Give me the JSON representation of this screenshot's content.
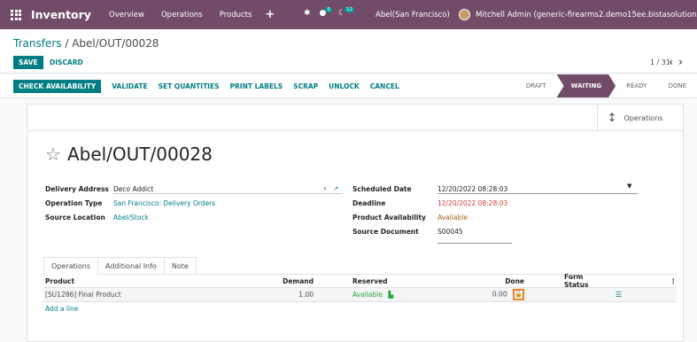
{
  "topbar": {
    "brand": "Inventory",
    "menu": [
      "Overview",
      "Operations",
      "Products"
    ],
    "plus": "+",
    "activity_count": "5",
    "messages_count": "12",
    "company": "Abel(San Francisco)",
    "user": "Mitchell Admin (generic-firearms2.demo15ee.bistasolutions.com)"
  },
  "control": {
    "breadcrumb_parent": "Transfers",
    "breadcrumb_sep": " / ",
    "breadcrumb_current": "Abel/OUT/00028",
    "save_label": "SAVE",
    "discard_label": "DISCARD",
    "pager": "1 / 31",
    "pager_prev": "‹",
    "pager_next": "›"
  },
  "actions": [
    "CHECK AVAILABILITY",
    "VALIDATE",
    "SET QUANTITIES",
    "PRINT LABELS",
    "SCRAP",
    "UNLOCK",
    "CANCEL"
  ],
  "states": [
    "DRAFT",
    "WAITING",
    "READY",
    "DONE"
  ],
  "active_state": "WAITING",
  "smart_button": "Operations",
  "title": "Abel/OUT/00028",
  "left_fields": [
    {
      "label": "Delivery Address",
      "value": "Deco Addict"
    },
    {
      "label": "Operation Type",
      "value": "San Francisco: Delivery Orders"
    },
    {
      "label": "Source Location",
      "value": "Abel/Stock"
    }
  ],
  "right_fields": [
    {
      "label": "Scheduled Date",
      "value": "12/20/2022 08:28:03"
    },
    {
      "label": "Deadline",
      "value": "12/20/2022 08:28:03"
    },
    {
      "label": "Product Availability",
      "value": "Available"
    },
    {
      "label": "Source Document",
      "value": "S00045"
    }
  ],
  "tabs": [
    "Operations",
    "Additional Info",
    "Note"
  ],
  "table": {
    "headers": [
      "Product",
      "Demand",
      "Reserved",
      "Done",
      "Form Status"
    ],
    "rows": [
      {
        "product": "[SU1286] Final Product",
        "demand": "1.00",
        "reserved": "Available",
        "done": "0.00"
      }
    ],
    "add_line": "Add a line"
  },
  "colors": {
    "brand": "#714b67",
    "accent": "#017e84",
    "deadline": "#d23f3a",
    "available": "#a16618",
    "highlight": "#f0832d"
  }
}
